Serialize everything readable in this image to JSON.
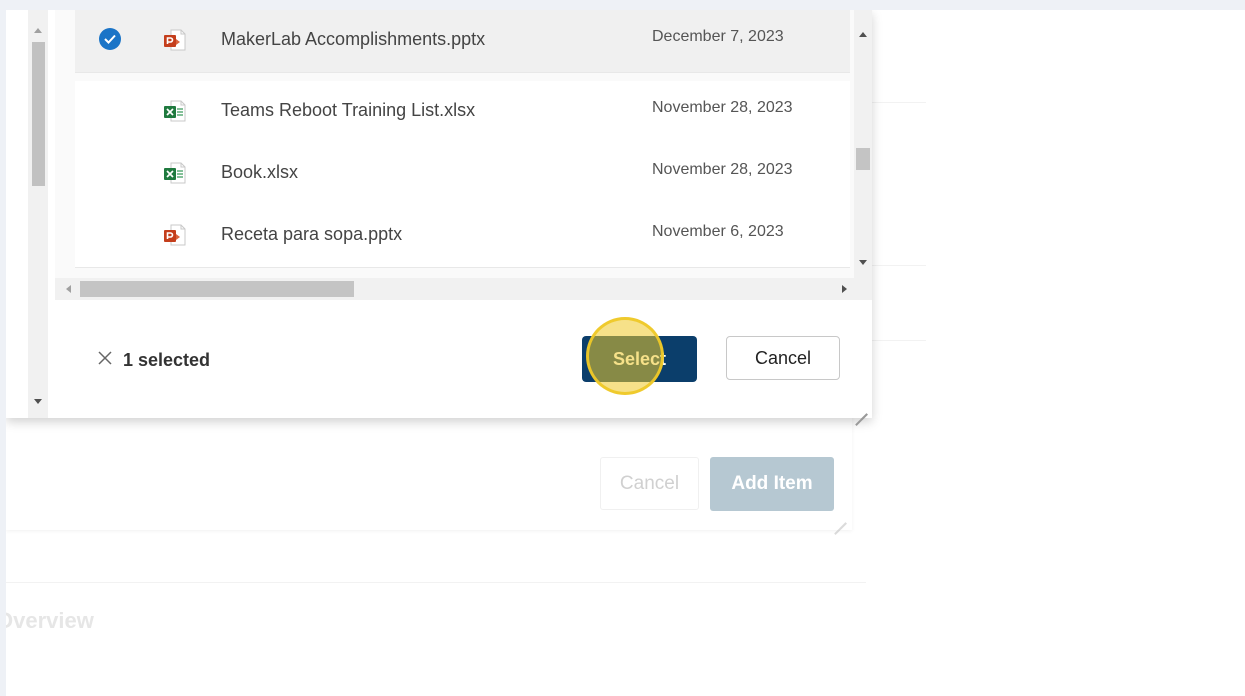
{
  "picker": {
    "files": [
      {
        "name": "MakerLab Accomplishments.pptx",
        "date": "December 7, 2023",
        "type": "powerpoint",
        "selected": true
      },
      {
        "name": "Teams Reboot Training List.xlsx",
        "date": "November 28, 2023",
        "type": "excel",
        "selected": false
      },
      {
        "name": "Book.xlsx",
        "date": "November 28, 2023",
        "type": "excel",
        "selected": false
      },
      {
        "name": "Receta para sopa.pptx",
        "date": "November 6, 2023",
        "type": "powerpoint",
        "selected": false
      }
    ],
    "footer": {
      "selected_text": "1 selected",
      "select_label": "Select",
      "cancel_label": "Cancel"
    }
  },
  "background_form": {
    "cancel_label": "Cancel",
    "add_item_label": "Add Item",
    "section_label": "Overview"
  },
  "colors": {
    "select_button": "#0b3e6b",
    "checkmark": "#1a74c7",
    "powerpoint": "#c43e1c",
    "excel": "#1f7a3f",
    "click_highlight": "#eec828"
  },
  "icons": {
    "checkmark": "check-circle-icon",
    "powerpoint": "powerpoint-file-icon",
    "excel": "excel-file-icon",
    "deselect": "close-icon",
    "resize": "resize-grip-icon"
  }
}
